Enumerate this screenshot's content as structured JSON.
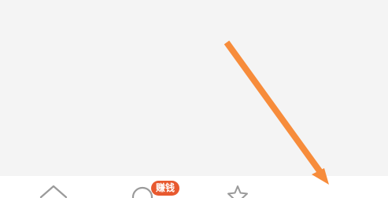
{
  "colors": {
    "background": "#f4f4f4",
    "tab_bar": "#ffffff",
    "badge": "#e8592f",
    "arrow": "#f78c3b",
    "icon_stroke": "#9a9a9a"
  },
  "tab_bar": {
    "tabs": [
      {
        "icon": "home-icon"
      },
      {
        "icon": "earn-icon",
        "badge": "赚钱"
      },
      {
        "icon": "star-icon"
      }
    ]
  },
  "annotation": {
    "icon": "arrow-pointer",
    "color": "#f78c3b"
  }
}
